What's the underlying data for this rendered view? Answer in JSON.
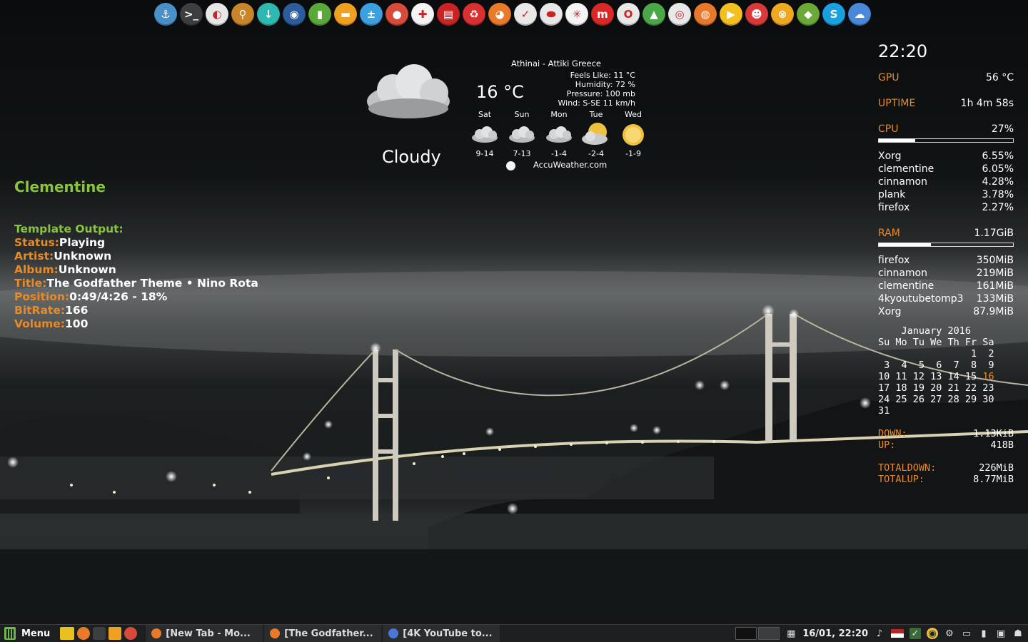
{
  "dock": {
    "icons": [
      {
        "name": "anchor-icon",
        "glyph": "⚓",
        "color": "#4a90c8"
      },
      {
        "name": "terminal-icon",
        "glyph": ">_",
        "color": "#3c3f41"
      },
      {
        "name": "toggle-icon",
        "glyph": "◐",
        "color": "#e8e8e8"
      },
      {
        "name": "search-icon",
        "glyph": "⚲",
        "color": "#c8852a"
      },
      {
        "name": "download-icon",
        "glyph": "↓",
        "color": "#2fb8b0"
      },
      {
        "name": "browser-icon",
        "glyph": "◉",
        "color": "#2c5c9a"
      },
      {
        "name": "usb-icon",
        "glyph": "▮",
        "color": "#5aa83a"
      },
      {
        "name": "folder-icon",
        "glyph": "▬",
        "color": "#f0a020"
      },
      {
        "name": "calculator-icon",
        "glyph": "±",
        "color": "#3aa0e0"
      },
      {
        "name": "record-icon",
        "glyph": "●",
        "color": "#d84a3a"
      },
      {
        "name": "apps-icon",
        "glyph": "✚",
        "color": "#f4f4f4"
      },
      {
        "name": "pdf-icon",
        "glyph": "▤",
        "color": "#c82424"
      },
      {
        "name": "recycle-icon",
        "glyph": "♻",
        "color": "#d83030"
      },
      {
        "name": "firefox-icon",
        "glyph": "◕",
        "color": "#e87a2a"
      },
      {
        "name": "tasks-icon",
        "glyph": "✓",
        "color": "#e8e8e8"
      },
      {
        "name": "shape-icon",
        "glyph": "⬬",
        "color": "#e8e8e8"
      },
      {
        "name": "pinwheel-icon",
        "glyph": "✳",
        "color": "#f4f4f4"
      },
      {
        "name": "m-app-icon",
        "glyph": "m",
        "color": "#d82828"
      },
      {
        "name": "opera-icon",
        "glyph": "O",
        "color": "#e8e8e8"
      },
      {
        "name": "image-viewer-icon",
        "glyph": "▲",
        "color": "#4aa848"
      },
      {
        "name": "chrome-icon",
        "glyph": "◎",
        "color": "#e8e8e8"
      },
      {
        "name": "basketball-icon",
        "glyph": "◍",
        "color": "#e8782a"
      },
      {
        "name": "media-player-icon",
        "glyph": "▶",
        "color": "#f4c020"
      },
      {
        "name": "game-icon",
        "glyph": "☻",
        "color": "#d83a3a"
      },
      {
        "name": "xbmc-icon",
        "glyph": "⊗",
        "color": "#f0a820"
      },
      {
        "name": "fruit-icon",
        "glyph": "◆",
        "color": "#6aa838"
      },
      {
        "name": "skype-icon",
        "glyph": "S",
        "color": "#1aa0e0"
      },
      {
        "name": "cloud-sync-icon",
        "glyph": "☁",
        "color": "#4a88d8"
      }
    ]
  },
  "weather": {
    "location": "Athinai - Attiki Greece",
    "temperature": "16 °C",
    "condition": "Cloudy",
    "feels_like": "Feels Like: 11 °C",
    "humidity": "Humidity: 72 %",
    "pressure": "Pressure: 100 mb",
    "wind": "Wind: S-SE 11 km/h",
    "source": "AccuWeather.com",
    "forecast": [
      {
        "day": "Sat",
        "range": "9-14",
        "icon": "cloud"
      },
      {
        "day": "Sun",
        "range": "7-13",
        "icon": "cloud"
      },
      {
        "day": "Mon",
        "range": "-1-4",
        "icon": "cloud"
      },
      {
        "day": "Tue",
        "range": "-2-4",
        "icon": "sun-cloud"
      },
      {
        "day": "Wed",
        "range": "-1-9",
        "icon": "sun"
      }
    ]
  },
  "clementine": {
    "title": "Clementine",
    "heading": "Template Output:",
    "rows": [
      {
        "key": "Status:",
        "value": "Playing"
      },
      {
        "key": "Artist:",
        "value": "Unknown"
      },
      {
        "key": "Album:",
        "value": "Unknown"
      },
      {
        "key": "Title:",
        "value": "The Godfather Theme • Nino Rota"
      },
      {
        "key": "Position:",
        "value": "0:49/4:26 - 18%"
      },
      {
        "key": "BitRate:",
        "value": "166"
      },
      {
        "key": "Volume:",
        "value": "100"
      }
    ]
  },
  "conky": {
    "time": "22:20",
    "gpu_label": "GPU",
    "gpu_value": "56 °C",
    "uptime_label": "UPTIME",
    "uptime_value": "1h 4m 58s",
    "cpu_label": "CPU",
    "cpu_value": "27%",
    "cpu_fraction": 0.27,
    "cpu_procs": [
      {
        "name": "Xorg",
        "value": "6.55%"
      },
      {
        "name": "clementine",
        "value": "6.05%"
      },
      {
        "name": "cinnamon",
        "value": "4.28%"
      },
      {
        "name": "plank",
        "value": "3.78%"
      },
      {
        "name": "firefox",
        "value": "2.27%"
      }
    ],
    "ram_label": "RAM",
    "ram_value": "1.17GiB",
    "ram_fraction": 0.39,
    "ram_procs": [
      {
        "name": "firefox",
        "value": "350MiB"
      },
      {
        "name": "cinnamon",
        "value": "219MiB"
      },
      {
        "name": "clementine",
        "value": "161MiB"
      },
      {
        "name": "4kyoutubetomp3",
        "value": "133MiB"
      },
      {
        "name": "Xorg",
        "value": "87.9MiB"
      }
    ],
    "calendar": {
      "title": "    January 2016",
      "header": "Su Mo Tu We Th Fr Sa",
      "week1": "                1  2",
      "week2": " 3  4  5  6  7  8  9",
      "week3_pre": "10 11 12 13 14 15 ",
      "today": "16",
      "week4": "17 18 19 20 21 22 23",
      "week5": "24 25 26 27 28 29 30",
      "week6": "31"
    },
    "down_label": "DOWN:",
    "down_value": "1.13KiB",
    "up_label": "UP:",
    "up_value": "418B",
    "totaldown_label": "TOTALDOWN:",
    "totaldown_value": "226MiB",
    "totalup_label": "TOTALUP:",
    "totalup_value": "8.77MiB"
  },
  "taskbar": {
    "menu_label": "Menu",
    "tasks": [
      {
        "label": "[New Tab - Mo...",
        "icon_color": "#e87a2a"
      },
      {
        "label": "[The Godfather...",
        "icon_color": "#e8782a"
      },
      {
        "label": "[4K YouTube to...",
        "icon_color": "#4a78d8"
      }
    ],
    "clock": "16/01, 22:20"
  }
}
